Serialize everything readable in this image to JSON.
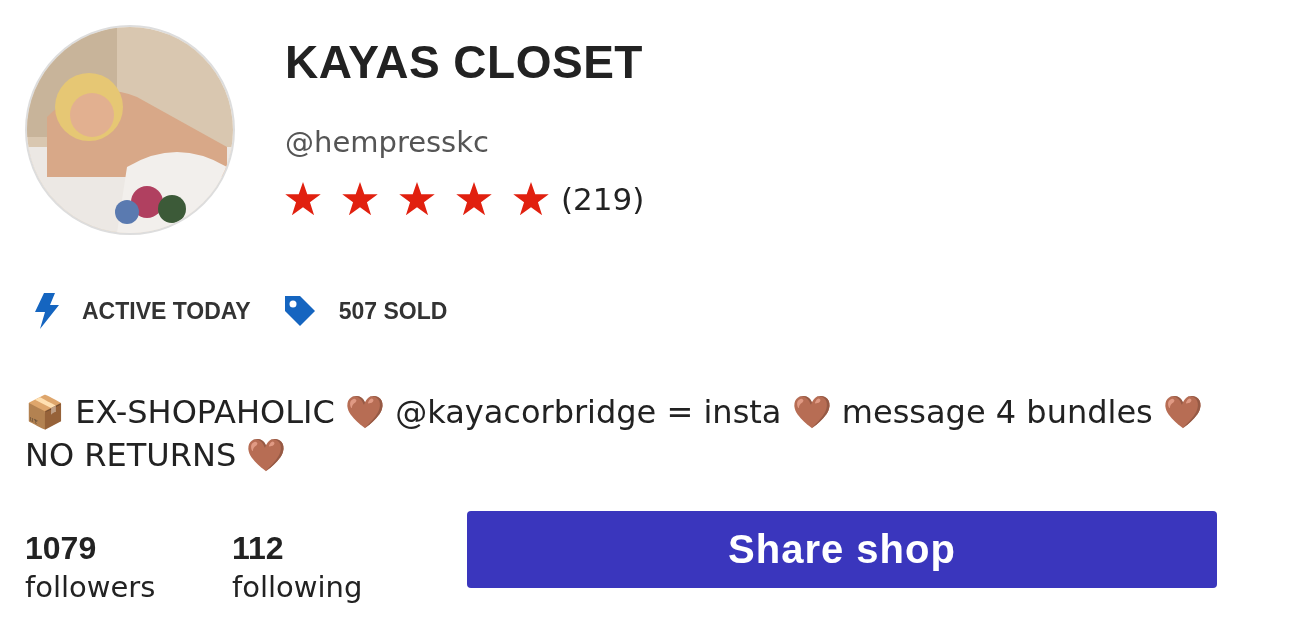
{
  "shop": {
    "name": "KAYAS CLOSET",
    "handle": "@hempresskc",
    "stars": 5,
    "review_count": "(219)"
  },
  "badges": [
    {
      "kind": "activity",
      "label": "ACTIVE TODAY"
    },
    {
      "kind": "sold",
      "label": "507 SOLD"
    }
  ],
  "bio": "📦 EX-SHOPAHOLIC 🤎 @kayacorbridge = insta 🤎 message 4 bundles 🤎 NO RETURNS 🤎",
  "stats": [
    {
      "count": "1079",
      "label": "followers"
    },
    {
      "count": "112",
      "label": "following"
    }
  ],
  "share_button": "Share shop"
}
